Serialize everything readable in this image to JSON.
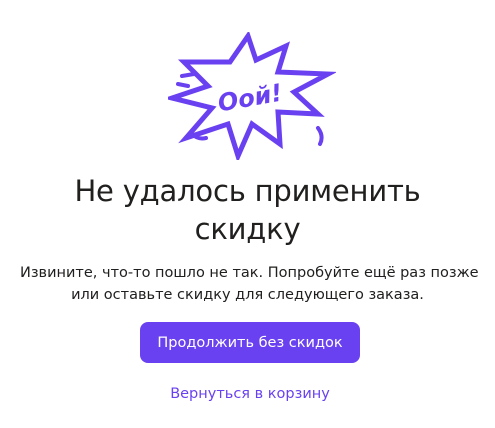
{
  "dialog": {
    "illustration": {
      "text": "Оой!",
      "icon": "burst-icon",
      "color": "#6a41f0"
    },
    "title_line1": "Не удалось применить",
    "title_line2": "скидку",
    "description_line1": "Извините, что-то пошло не так. Попробуйте ещё раз позже",
    "description_line2": "или оставьте скидку для следующего заказа.",
    "continue_label": "Продолжить без скидок",
    "back_label": "Вернуться в корзину",
    "accent_color": "#6a41f0"
  }
}
